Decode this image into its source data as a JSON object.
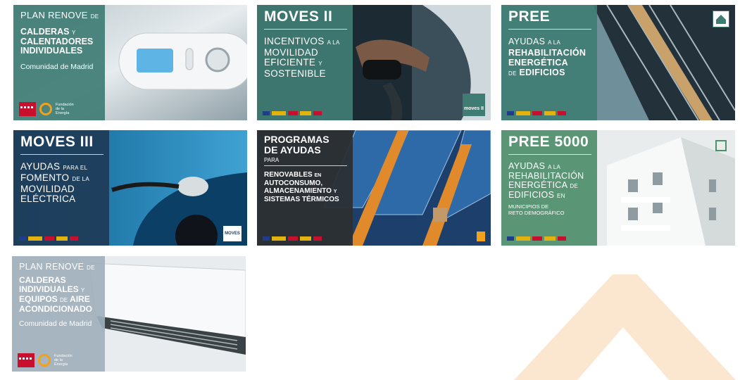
{
  "colors": {
    "watermark": "#fbe7d0",
    "panel_teal": "#3f7d74",
    "panel_navy": "#1f3d5a",
    "panel_dark": "#2c2f33",
    "panel_green": "#4f8f6d",
    "panel_slate": "#9fb0bb",
    "accent_orange": "#f2a11b"
  },
  "cards": [
    {
      "title_top": "PLAN RENOVE",
      "title_top_small": "DE",
      "title_bold_1": "CALDERAS",
      "title_bold_1_small": "Y",
      "title_bold_2": "CALENTADORES",
      "title_bold_3": "INDIVIDUALES",
      "region": "Comunidad de Madrid",
      "footer_text": "Fundación de la Energía",
      "icon": "thermostat-photo"
    },
    {
      "title": "MOVES II",
      "line1": "INCENTIVOS",
      "line1_small": "A LA",
      "line2": "MOVILIDAD",
      "line3": "EFICIENTE",
      "line3_small": "Y",
      "line4": "SOSTENIBLE",
      "badge": "moves II",
      "icon": "ev-charging-photo"
    },
    {
      "title": "PREE",
      "line1": "AYUDAS",
      "line1_small": "A LA",
      "line2": "REHABILITACIÓN",
      "line3": "ENERGÉTICA",
      "line4_small": "DE",
      "line4": "EDIFICIOS",
      "icon": "building-facade-photo"
    },
    {
      "title": "MOVES III",
      "line1": "AYUDAS",
      "line1_small": "PARA EL",
      "line2": "FOMENTO",
      "line2_small": "DE LA",
      "line3": "MOVILIDAD",
      "line4": "ELÉCTRICA",
      "badge": "MOVES",
      "icon": "ev-car-charging-photo"
    },
    {
      "title_1": "PROGRAMAS",
      "title_2": "DE AYUDAS",
      "line_small": "PARA",
      "line1": "RENOVABLES",
      "line1_small": "EN",
      "line2": "AUTOCONSUMO,",
      "line3": "ALMACENAMIENTO",
      "line3_small": "Y",
      "line4": "SISTEMAS TÉRMICOS",
      "icon": "solar-panels-photo"
    },
    {
      "title": "PREE 5000",
      "line1": "AYUDAS",
      "line1_small": "A LA",
      "line2": "REHABILITACIÓN",
      "line3": "ENERGÉTICA",
      "line3_small": "DE",
      "line4": "EDIFICIOS",
      "line4_small": "EN",
      "line5": "MUNICIPIOS",
      "line5_small": "DE",
      "line6": "RETO DEMOGRÁFICO",
      "icon": "white-building-photo"
    },
    {
      "title_top": "PLAN RENOVE",
      "title_top_small": "DE",
      "title_bold_1": "CALDERAS",
      "title_bold_2": "INDIVIDUALES",
      "title_bold_2_small": "Y",
      "title_bold_3": "EQUIPOS",
      "title_bold_3_small": "DE",
      "title_bold_3b": "AIRE",
      "title_bold_4": "ACONDICIONADO",
      "region": "Comunidad de Madrid",
      "footer_text": "Fundación de la Energía",
      "icon": "air-conditioner-photo"
    }
  ]
}
